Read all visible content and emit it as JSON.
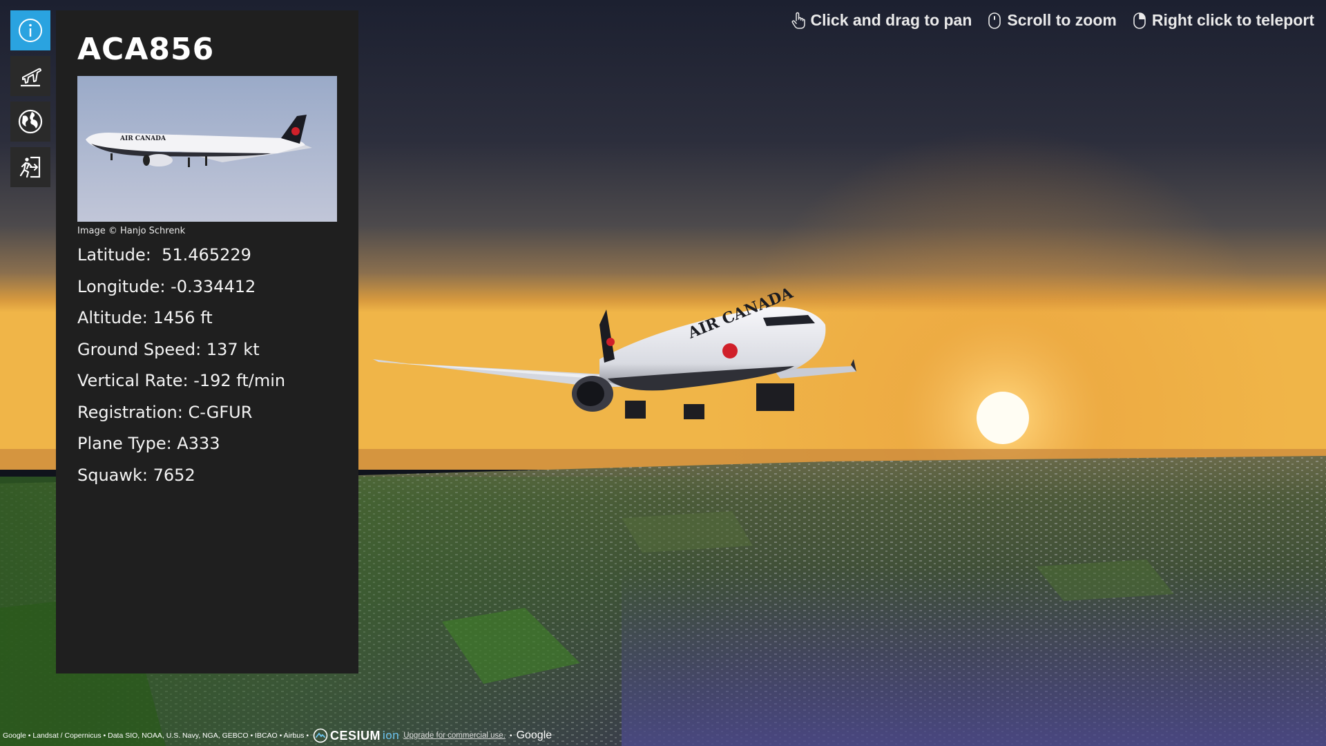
{
  "panel": {
    "callsign": "ACA856",
    "photo_credit": "Image © Hanjo Schrenk",
    "photo_livery_text": "AIR CANADA",
    "fields": [
      "Latitude:  51.465229",
      "Longitude: -0.334412",
      "Altitude: 1456 ft",
      "Ground Speed: 137 kt",
      "Vertical Rate: -192 ft/min",
      "Registration: C-GFUR",
      "Plane Type: A333",
      "Squawk: 7652"
    ]
  },
  "toolbar": {
    "buttons": [
      {
        "icon": "info-icon",
        "active": true
      },
      {
        "icon": "airplane-landing-icon",
        "active": false
      },
      {
        "icon": "globe-icon",
        "active": false
      },
      {
        "icon": "exit-run-icon",
        "active": false
      }
    ],
    "accent": "#2aa3e0"
  },
  "hints": {
    "pan": "Click and drag to pan",
    "zoom": "Scroll to zoom",
    "teleport": "Right click to teleport"
  },
  "credits": {
    "attribution": "Google • Landsat / Copernicus • Data SIO, NOAA, U.S. Navy, NGA, GEBCO • IBCAO • Airbus •",
    "cesium": "CESIUM",
    "ion": "ion",
    "upgrade": "Upgrade for commercial use.",
    "separator": "•",
    "google": "Google"
  },
  "scene": {
    "livery_text": "AIR CANADA"
  }
}
